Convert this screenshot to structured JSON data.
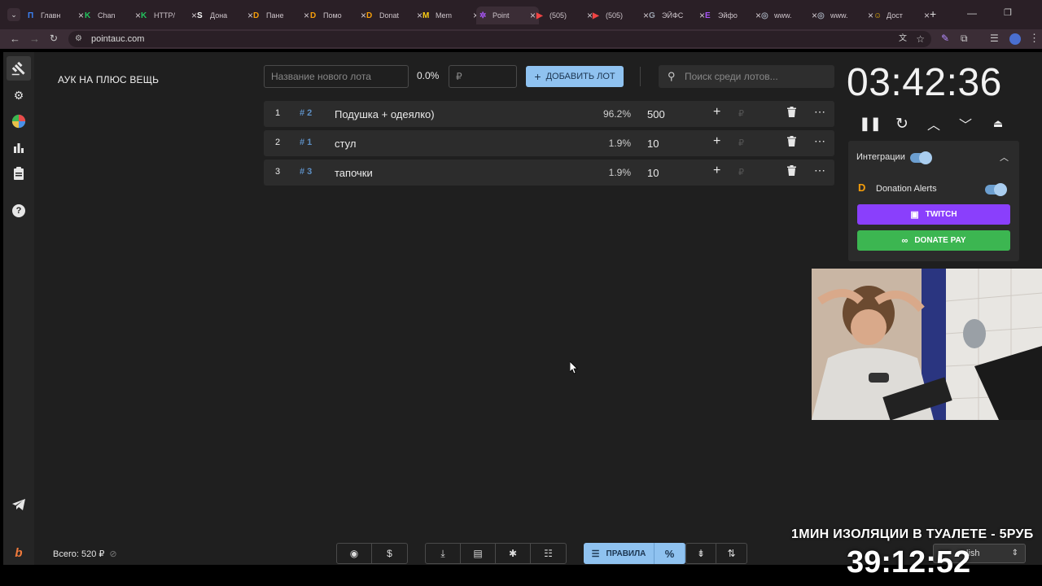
{
  "browser": {
    "tabs": [
      {
        "label": "Главн",
        "fav": "#3b82f6",
        "glyph": "П"
      },
      {
        "label": "Chan",
        "fav": "#22c55e",
        "glyph": "K"
      },
      {
        "label": "HTTP/",
        "fav": "#22c55e",
        "glyph": "K"
      },
      {
        "label": "Дона",
        "fav": "#ffffff",
        "glyph": "S"
      },
      {
        "label": "Пане",
        "fav": "#f59e0b",
        "glyph": "D"
      },
      {
        "label": "Помо",
        "fav": "#f59e0b",
        "glyph": "D"
      },
      {
        "label": "Donat",
        "fav": "#f59e0b",
        "glyph": "D"
      },
      {
        "label": "Mem",
        "fav": "#facc15",
        "glyph": "M"
      },
      {
        "label": "Point",
        "fav": "#a855f7",
        "glyph": "✲"
      },
      {
        "label": "(505)",
        "fav": "#ef4444",
        "glyph": "▶"
      },
      {
        "label": "(505)",
        "fav": "#ef4444",
        "glyph": "▶"
      },
      {
        "label": "ЭЙФС",
        "fav": "#9ca3af",
        "glyph": "G"
      },
      {
        "label": "Эйфо",
        "fav": "#a855f7",
        "glyph": "E"
      },
      {
        "label": "www.",
        "fav": "#9ca3af",
        "glyph": "◎"
      },
      {
        "label": "www.",
        "fav": "#9ca3af",
        "glyph": "◎"
      },
      {
        "label": "Дост",
        "fav": "#eab308",
        "glyph": "☺"
      }
    ],
    "url": "pointauc.com"
  },
  "auction": {
    "title": "АУК НА ПЛЮС ВЕЩЬ",
    "new_lot_placeholder": "Название нового лота",
    "new_lot_percent": "0.0%",
    "currency_placeholder": "₽",
    "add_lot_label": "ДОБАВИТЬ ЛОТ",
    "search_placeholder": "Поиск среди лотов...",
    "lots": [
      {
        "index": "1",
        "fast_id": "# 2",
        "name": "Подушка + одеялко)",
        "percent": "96.2%",
        "amount": "500",
        "currency": "₽"
      },
      {
        "index": "2",
        "fast_id": "# 1",
        "name": "стул",
        "percent": "1.9%",
        "amount": "10",
        "currency": "₽"
      },
      {
        "index": "3",
        "fast_id": "# 3",
        "name": "тапочки",
        "percent": "1.9%",
        "amount": "10",
        "currency": "₽"
      }
    ],
    "total": "Всего: 520 ₽"
  },
  "timer": {
    "value": "03:42:36"
  },
  "integrations": {
    "title": "Интеграции",
    "donation_alerts": "Donation Alerts",
    "twitch_label": "TWITCH",
    "donatepay_label": "DONATE PAY",
    "twitch_color": "#8a3ffc",
    "donatepay_color": "#3cb651"
  },
  "bottom_bar": {
    "rules_label": "ПРАВИЛА",
    "percent_symbol": "%"
  },
  "stream_overlay": {
    "caption": "1МИН ИЗОЛЯЦИИ В ТУАЛЕТЕ - 5РУБ",
    "timer": "39:12:52",
    "language": "lish"
  }
}
